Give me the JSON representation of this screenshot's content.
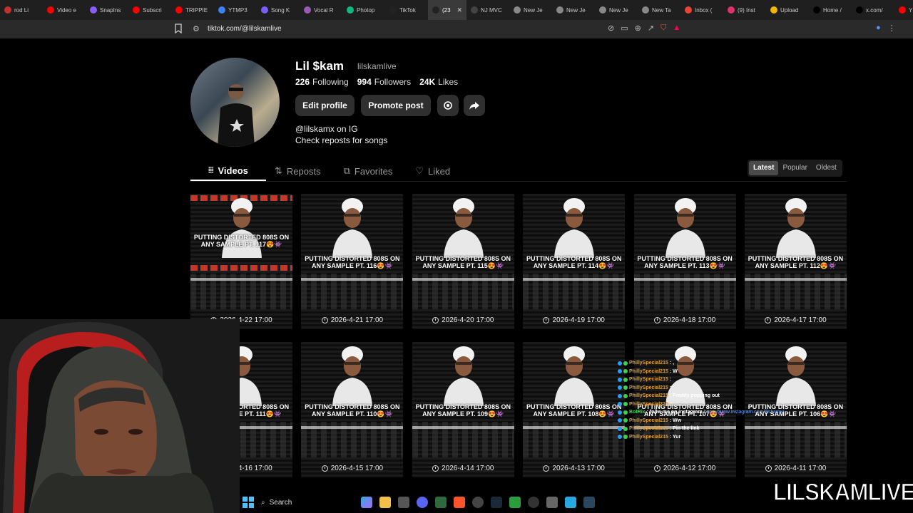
{
  "browser": {
    "tabs": [
      {
        "label": "rod Li",
        "color": "#c4302b"
      },
      {
        "label": "Video e",
        "color": "#ff0000"
      },
      {
        "label": "SnapIns",
        "color": "#8a5cf6"
      },
      {
        "label": "Subscri",
        "color": "#ff0000"
      },
      {
        "label": "TRIPPIE",
        "color": "#ff0000"
      },
      {
        "label": "YTMP3",
        "color": "#3b82f6"
      },
      {
        "label": "Song K",
        "color": "#7c5cff"
      },
      {
        "label": "Vocal R",
        "color": "#9b59b6"
      },
      {
        "label": "Photop",
        "color": "#10b981"
      },
      {
        "label": "TikTok",
        "color": "#222222"
      },
      {
        "label": "(23",
        "color": "#222222"
      },
      {
        "label": "NJ MVC",
        "color": "#444444"
      },
      {
        "label": "New Je",
        "color": "#888888"
      },
      {
        "label": "New Je",
        "color": "#888888"
      },
      {
        "label": "New Je",
        "color": "#888888"
      },
      {
        "label": "New Ta",
        "color": "#888888"
      },
      {
        "label": "Inbox (",
        "color": "#ea4335"
      },
      {
        "label": "(9) Inst",
        "color": "#e1306c"
      },
      {
        "label": "Upload",
        "color": "#f4b400"
      },
      {
        "label": "Home /",
        "color": "#000000"
      },
      {
        "label": "x.com/",
        "color": "#000000"
      },
      {
        "label": "YNW",
        "color": "#ff0000"
      }
    ],
    "active_tab_index": 10,
    "url": "tiktok.com/@lilskamlive"
  },
  "profile": {
    "display_name": "Lil $kam",
    "username": "lilskamlive",
    "following_count": "226",
    "following_label": "Following",
    "followers_count": "994",
    "followers_label": "Followers",
    "likes_count": "24K",
    "likes_label": "Likes",
    "edit_label": "Edit profile",
    "promote_label": "Promote post",
    "bio_line1": "@lilskamx on IG",
    "bio_line2": "Check reposts for songs"
  },
  "tabs": {
    "videos": "Videos",
    "reposts": "Reposts",
    "favorites": "Favorites",
    "liked": "Liked"
  },
  "sort": {
    "latest": "Latest",
    "popular": "Popular",
    "oldest": "Oldest",
    "selected": "Latest"
  },
  "videos": [
    {
      "title": "PUTTING DISTORTED 808S ON ANY SAMPLE PT. 117😍👾",
      "date": "2026-4-22 17:00"
    },
    {
      "title": "PUTTING DISTORTED 808S ON ANY SAMPLE PT. 116😍👾",
      "date": "2026-4-21 17:00"
    },
    {
      "title": "PUTTING DISTORTED 808S ON ANY SAMPLE PT. 115😍👾",
      "date": "2026-4-20 17:00"
    },
    {
      "title": "PUTTING DISTORTED 808S ON ANY SAMPLE PT. 114😍👾",
      "date": "2026-4-19 17:00"
    },
    {
      "title": "PUTTING DISTORTED 808S ON ANY SAMPLE PT. 113😍👾",
      "date": "2026-4-18 17:00"
    },
    {
      "title": "PUTTING DISTORTED 808S ON ANY SAMPLE PT. 112😍👾",
      "date": "2026-4-17 17:00"
    },
    {
      "title": "PUTTING DISTORTED 808S ON ANY SAMPLE PT. 111😍👾",
      "date": "2026-4-16 17:00"
    },
    {
      "title": "PUTTING DISTORTED 808S ON ANY SAMPLE PT. 110😍👾",
      "date": "2026-4-15 17:00"
    },
    {
      "title": "PUTTING DISTORTED 808S ON ANY SAMPLE PT. 109😍👾",
      "date": "2026-4-14 17:00"
    },
    {
      "title": "PUTTING DISTORTED 808S ON ANY SAMPLE PT. 108😍👾",
      "date": "2026-4-13 17:00"
    },
    {
      "title": "PUTTING DISTORTED 808S ON ANY SAMPLE PT. 107😍👾",
      "date": "2026-4-12 17:00"
    },
    {
      "title": "PUTTING DISTORTED 808S ON ANY SAMPLE PT. 106😍👾",
      "date": "2026-4-11 17:00"
    }
  ],
  "chat": [
    {
      "user": "PhillySpecial215",
      "msg": ": ,",
      "link": ""
    },
    {
      "user": "PhillySpecial215",
      "msg": ": W",
      "link": ""
    },
    {
      "user": "PhillySpecial215",
      "msg": ":",
      "link": ""
    },
    {
      "user": "PhillySpecial215",
      "msg": ":",
      "link": ""
    },
    {
      "user": "PhillySpecial215",
      "msg": ": Freddy popping out",
      "link": ""
    },
    {
      "user": "PhillySpecial215",
      "msg": ":",
      "link": ""
    },
    {
      "user": "BotRix",
      "msg": ": follw me on instagram",
      "link": "https://www.instagram.com/lilskamx/",
      "bot": true
    },
    {
      "user": "PhillySpecial215",
      "msg": ": Ww",
      "link": ""
    },
    {
      "user": "PhillySpecial215",
      "msg": ": Pin the link",
      "link": ""
    },
    {
      "user": "PhillySpecial215",
      "msg": ": Yur",
      "link": ""
    }
  ],
  "taskbar": {
    "search_label": "Search"
  },
  "watermark": "LILSKAMLIVE",
  "colors": {
    "accent_blue": "#4cc2ff",
    "chat_user": "#e0a030",
    "chat_bot": "#39d353",
    "chat_link": "#6aa0ff"
  }
}
